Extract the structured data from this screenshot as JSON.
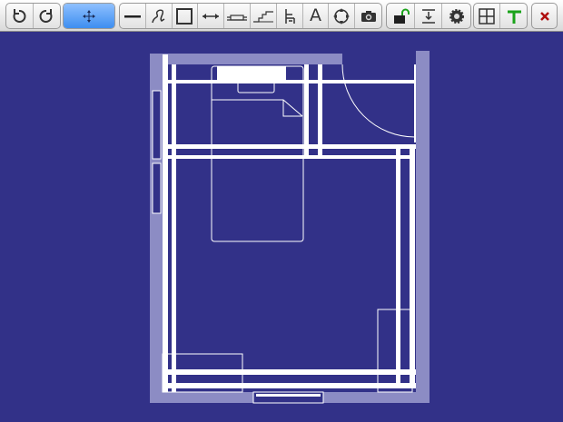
{
  "toolbar": {
    "groups": [
      {
        "name": "history",
        "buttons": [
          {
            "name": "undo-button",
            "icon": "undo-icon"
          },
          {
            "name": "redo-button",
            "icon": "redo-icon"
          }
        ]
      },
      {
        "name": "select",
        "buttons": [
          {
            "name": "select-move-button",
            "icon": "move-arrows-icon",
            "active": true
          }
        ]
      },
      {
        "name": "draw",
        "buttons": [
          {
            "name": "wall-tool-button",
            "icon": "straight-line-icon"
          },
          {
            "name": "freehand-tool-button",
            "icon": "freehand-curve-icon"
          },
          {
            "name": "room-tool-button",
            "icon": "rectangle-icon"
          },
          {
            "name": "dimension-tool-button",
            "icon": "double-arrow-icon"
          },
          {
            "name": "window-tool-button",
            "icon": "window-icon"
          },
          {
            "name": "stairs-tool-button",
            "icon": "stairs-icon"
          },
          {
            "name": "furniture-tool-button",
            "icon": "chair-icon"
          },
          {
            "name": "text-tool-button",
            "icon": "text-icon",
            "label": "A"
          },
          {
            "name": "compass-tool-button",
            "icon": "compass-icon"
          },
          {
            "name": "camera-tool-button",
            "icon": "camera-icon"
          }
        ]
      },
      {
        "name": "settings",
        "buttons": [
          {
            "name": "unlock-button",
            "icon": "unlock-icon"
          },
          {
            "name": "level-button",
            "icon": "level-icon"
          },
          {
            "name": "settings-button",
            "icon": "gear-icon"
          }
        ]
      },
      {
        "name": "view",
        "buttons": [
          {
            "name": "grid-button",
            "icon": "grid-icon"
          },
          {
            "name": "snap-button",
            "icon": "snap-corner-icon"
          }
        ]
      },
      {
        "name": "close",
        "buttons": [
          {
            "name": "close-button",
            "icon": "close-icon"
          }
        ]
      }
    ]
  },
  "colors": {
    "canvas": "#323188",
    "wall_outer": "#8c8cc4",
    "wall_inner": "#ffffff",
    "accent_active": "#3d8ef0",
    "close_red": "#b01010",
    "snap_green": "#1aa31a",
    "lock_green": "#1aa31a"
  }
}
